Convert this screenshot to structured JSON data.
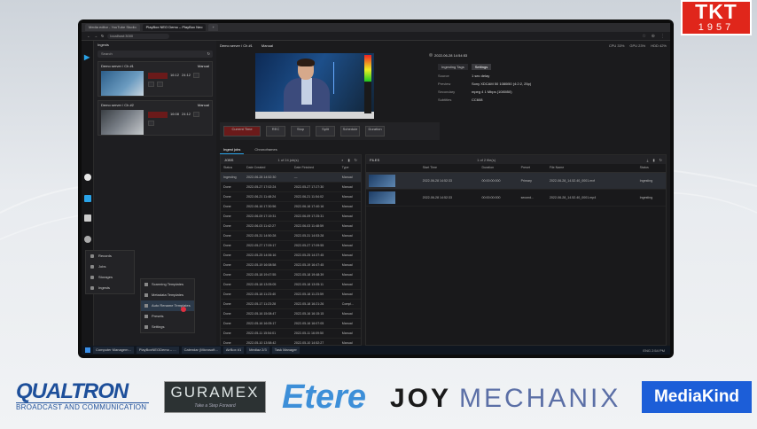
{
  "corner_logo": {
    "brand": "TKT",
    "year": "1957"
  },
  "browser": {
    "tabs": [
      "Media editor - YouTube Studio",
      "PlayBox NEO Demo – PlayBox Neo",
      "+"
    ],
    "address": "localhost:3000",
    "extensions": [
      "☆",
      "⊕",
      "⋮"
    ]
  },
  "app": {
    "left_header": "Ingests",
    "search_placeholder": "Search",
    "cards": [
      {
        "title": "Demo server / Ch #1",
        "status": "Manual",
        "stat1": "16:12",
        "stat2": "24:12"
      },
      {
        "title": "Demo server / Ch #2",
        "status": "Manual",
        "stat1": "16:08",
        "stat2": "24:12"
      }
    ],
    "main_title": "Demo server / Ch #1",
    "main_status": "Manual",
    "timecode": "2022-06-28 14:54:53",
    "perf": [
      "CPU 33%",
      "GPU 23%",
      "HDD 42%"
    ],
    "info_tabs": [
      "Ingesting Tags",
      "Settings"
    ],
    "info_rows": [
      {
        "k": "Source",
        "v": "1 sec delay"
      },
      {
        "k": "Preview",
        "v": "Sony XDCAM 50 1080i50 (4:2:2, 25p)"
      },
      {
        "k": "Secondary",
        "v": "mpeg 4 1 Mbps (1080i50)"
      },
      {
        "k": "Subtitles",
        "v": "CC608"
      }
    ],
    "controls": [
      "Current Time",
      "REC",
      "Stop",
      "Split",
      "Schedule",
      "Duration"
    ],
    "subtabs": [
      "Ingest jobs",
      "Chronoframes"
    ],
    "jobs": {
      "title": "JOBS",
      "count": "1 of 24 job(s)",
      "columns": [
        "Status",
        "Date Created",
        "Date Finished",
        "Type"
      ],
      "rows": [
        [
          "Ingesting",
          "2022-06-28 14:52:30",
          "—",
          "Manual"
        ],
        [
          "Done",
          "2022-05-27 17:02:24",
          "2022-05-27 17:27:30",
          "Manual"
        ],
        [
          "Done",
          "2022-06-21 11:48:24",
          "2022-06-21 11:54:02",
          "Manual"
        ],
        [
          "Done",
          "2022-06-16 17:30:56",
          "2022-06-16 17:40:16",
          "Manual"
        ],
        [
          "Done",
          "2022-06-09 17:19:31",
          "2022-06-09 17:25:31",
          "Manual"
        ],
        [
          "Done",
          "2022-06-03 11:42:27",
          "2022-06-03 11:48:59",
          "Manual"
        ],
        [
          "Done",
          "2022-05-31 14:50:28",
          "2022-05-31 14:53:28",
          "Manual"
        ],
        [
          "Done",
          "2022-05-27 17:09:17",
          "2022-05-27 17:09:55",
          "Manual"
        ],
        [
          "Done",
          "2022-05-25 14:06:16",
          "2022-05-25 14:37:45",
          "Manual"
        ],
        [
          "Done",
          "2022-05-19 16:08:58",
          "2022-05-19 16:47:45",
          "Manual"
        ],
        [
          "Done",
          "2022-05-18 19:47:55",
          "2022-05-18 19:48:39",
          "Manual"
        ],
        [
          "Done",
          "2022-05-18 13:05:05",
          "2022-05-18 13:05:11",
          "Manual"
        ],
        [
          "Done",
          "2022-05-18 11:23:40",
          "2022-05-18 11:23:59",
          "Manual"
        ],
        [
          "Done",
          "2022-05-17 11:23:28",
          "2022-05-18 16:21:26",
          "Compl..."
        ],
        [
          "Done",
          "2022-05-16 15:08:47",
          "2022-05-16 16:15:15",
          "Manual"
        ],
        [
          "Done",
          "2022-05-16 16:05:17",
          "2022-05-16 16:07:05",
          "Manual"
        ],
        [
          "Done",
          "2022-05-11 15:54:01",
          "2022-05-11 16:09:50",
          "Manual"
        ],
        [
          "Done",
          "2022-05-10 13:58:42",
          "2022-05-10 14:52:27",
          "Manual"
        ],
        [
          "Done",
          "2022-05-10 13:04:23",
          "2022-05-10 13:41:38",
          "Manual"
        ]
      ]
    },
    "files": {
      "title": "FILES",
      "count": "1 of 2 file(s)",
      "columns": [
        "Start Time",
        "Duration",
        "Preset",
        "File Name",
        "Status"
      ],
      "rows": [
        [
          "2022-06-28 14:52:33",
          "00:00:00:000",
          "Primary",
          "2022-06-28_14.52.40_0001.mxf",
          "Ingesting"
        ],
        [
          "2022-06-28 14:52:33",
          "00:00:00:000",
          "second...",
          "2022-06-28_14.52.40_0001.mp4",
          "Ingesting"
        ]
      ]
    },
    "menu": [
      "Records",
      "Jobs",
      "Storages",
      "Ingests"
    ],
    "submenu": [
      "Scanning Templates",
      "Metadata Templates",
      "Auto Rename Templates",
      "Presets",
      "Settings"
    ],
    "taskbar": {
      "items": [
        "Computer Managem...",
        "PlayBoxNEODemo – ...",
        "Calendar (Microsoft...",
        "AirBox #1",
        "Mediaz 2/3",
        "Task Manager"
      ],
      "tray": "ENG  2:54 PM"
    }
  },
  "sponsors": {
    "qualtron": "QUALTRON",
    "qualtron_sub": "BROADCAST AND COMMUNICATION",
    "guramex": "GURAMEX",
    "guramex_tag": "Take a Step Forward",
    "etere": "Etere",
    "joy": "JOY",
    "mechanix": "MECHANIX",
    "mediakind": "MediaKind"
  }
}
